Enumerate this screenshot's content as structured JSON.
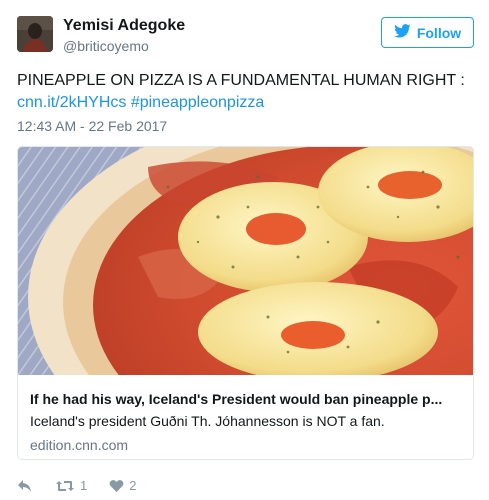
{
  "header": {
    "name": "Yemisi Adegoke",
    "handle": "@briticoyemo",
    "follow_label": "Follow"
  },
  "tweet": {
    "text": "PINEAPPLE ON PIZZA IS A FUNDAMENTAL HUMAN RIGHT :",
    "link": "cnn.it/2kHYHcs",
    "hashtag": "#pineappleonpizza",
    "timestamp": "12:43 AM - 22 Feb 2017"
  },
  "card": {
    "title": "If he had his way, Iceland's President would ban pineapple p...",
    "description": "Iceland's president Guðni Th. Jóhannesson is NOT a fan.",
    "domain": "edition.cnn.com"
  },
  "actions": {
    "retweet_count": "1",
    "like_count": "2"
  },
  "colors": {
    "accent": "#1da1f2",
    "link": "#1b95e0",
    "muted": "#657786",
    "icon": "#8899a6"
  }
}
